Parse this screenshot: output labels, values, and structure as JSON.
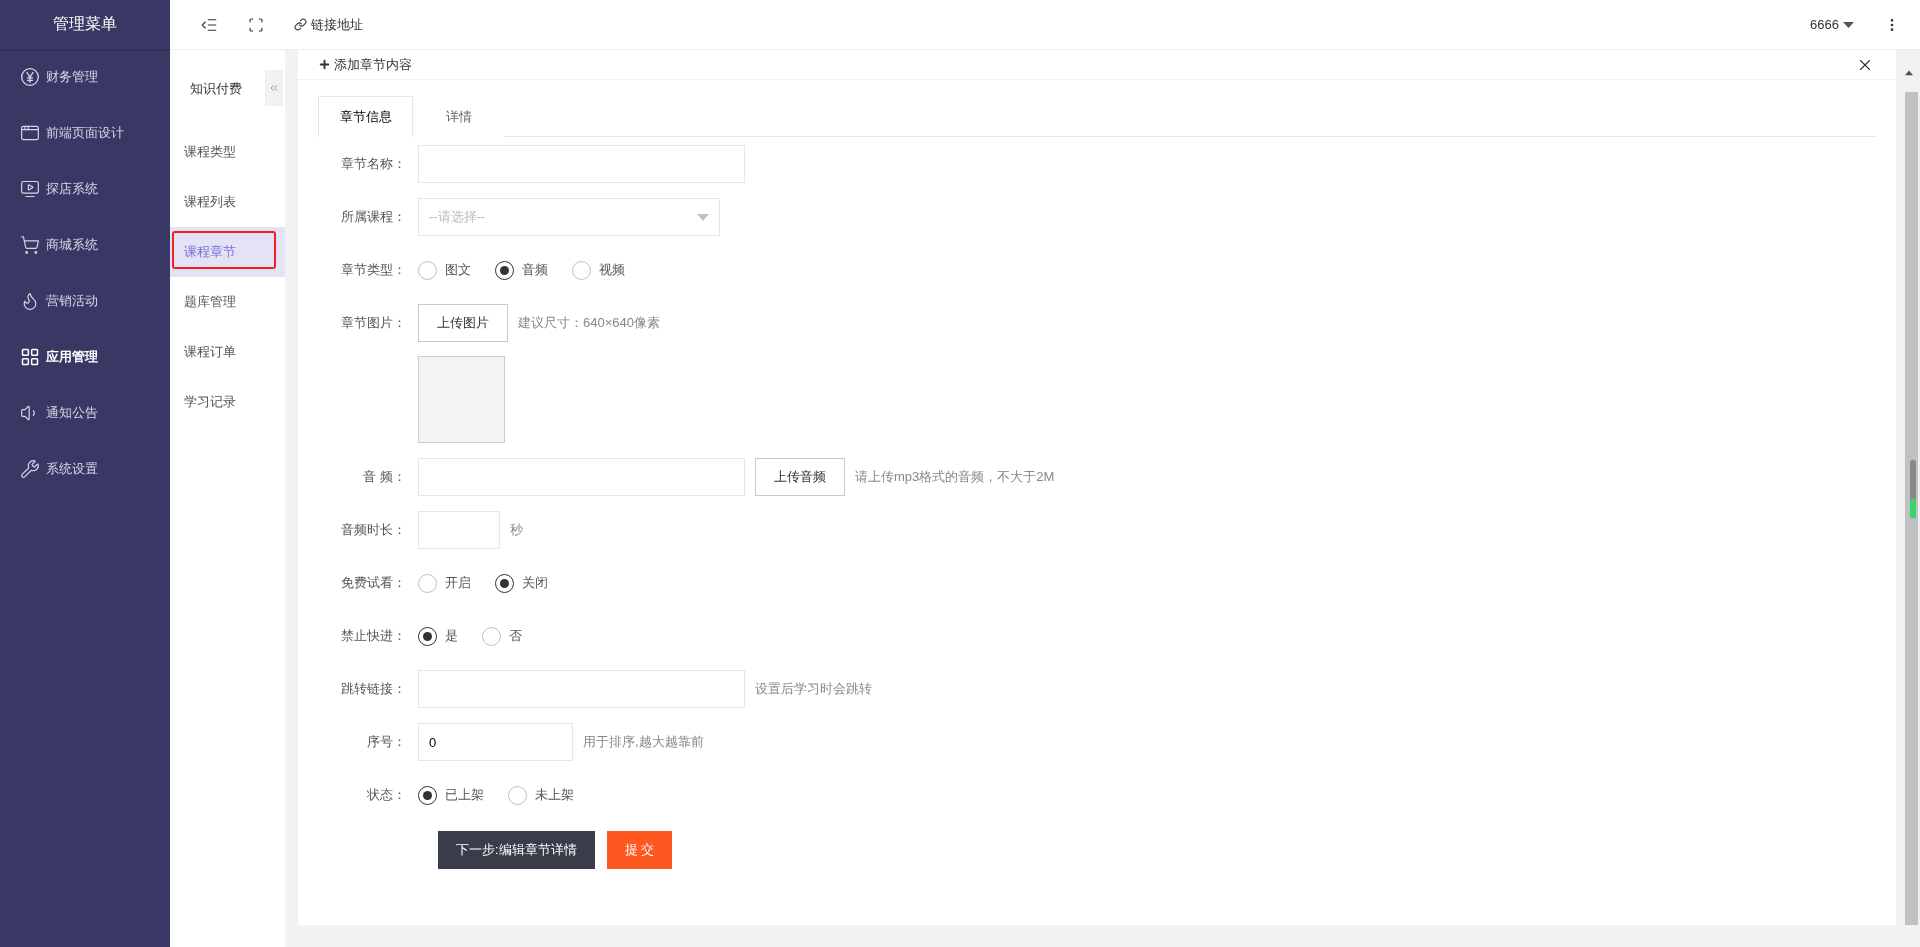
{
  "sidebar": {
    "title": "管理菜单",
    "items": [
      {
        "label": "财务管理",
        "selected": false
      },
      {
        "label": "前端页面设计",
        "selected": false
      },
      {
        "label": "探店系统",
        "selected": false
      },
      {
        "label": "商城系统",
        "selected": false
      },
      {
        "label": "营销活动",
        "selected": false
      },
      {
        "label": "应用管理",
        "selected": true
      },
      {
        "label": "通知公告",
        "selected": false
      },
      {
        "label": "系统设置",
        "selected": false
      }
    ]
  },
  "toolbar": {
    "link": "链接地址",
    "user": "6666"
  },
  "subnav": {
    "title": "知识付费",
    "items": [
      {
        "label": "课程类型",
        "selected": false,
        "outlined": false
      },
      {
        "label": "课程列表",
        "selected": false,
        "outlined": false
      },
      {
        "label": "课程章节",
        "selected": true,
        "outlined": true
      },
      {
        "label": "题库管理",
        "selected": false,
        "outlined": false
      },
      {
        "label": "课程订单",
        "selected": false,
        "outlined": false
      },
      {
        "label": "学习记录",
        "selected": false,
        "outlined": false
      }
    ]
  },
  "panel": {
    "title": "添加章节内容",
    "tabs": [
      {
        "label": "章节信息",
        "selected": true
      },
      {
        "label": "详情",
        "selected": false
      }
    ],
    "fields": [
      {
        "kind": "input",
        "label": "章节名称："
      },
      {
        "kind": "select",
        "label": "所属课程：",
        "placeholder": "--请选择--"
      },
      {
        "kind": "radio",
        "label": "章节类型：",
        "options": [
          {
            "label": "图文",
            "selected": false
          },
          {
            "label": "音频",
            "selected": true
          },
          {
            "label": "视频",
            "selected": false
          }
        ]
      },
      {
        "kind": "image",
        "label": "章节图片：",
        "button": "上传图片",
        "hint": "建议尺寸：640×640像素"
      },
      {
        "kind": "input",
        "label": "音 频：",
        "button": "上传音频",
        "hint": "请上传mp3格式的音频，不大于2M"
      },
      {
        "kind": "short-input",
        "label": "音频时长：",
        "hint": "秒"
      },
      {
        "kind": "radio",
        "label": "免费试看：",
        "options": [
          {
            "label": "开启",
            "selected": false
          },
          {
            "label": "关闭",
            "selected": true
          }
        ]
      },
      {
        "kind": "radio",
        "label": "禁止快进：",
        "options": [
          {
            "label": "是",
            "selected": true
          },
          {
            "label": "否",
            "selected": false
          }
        ]
      },
      {
        "kind": "input",
        "label": "跳转链接：",
        "hint": "设置后学习时会跳转"
      },
      {
        "kind": "medium-input",
        "label": "序号：",
        "value": "0",
        "hint": "用于排序,越大越靠前"
      },
      {
        "kind": "radio",
        "label": "状态：",
        "options": [
          {
            "label": "已上架",
            "selected": true
          },
          {
            "label": "未上架",
            "selected": false
          }
        ]
      }
    ],
    "buttons": [
      {
        "kind": "dark",
        "label": "下一步:编辑章节详情"
      },
      {
        "kind": "accent",
        "label": "提 交"
      }
    ]
  }
}
